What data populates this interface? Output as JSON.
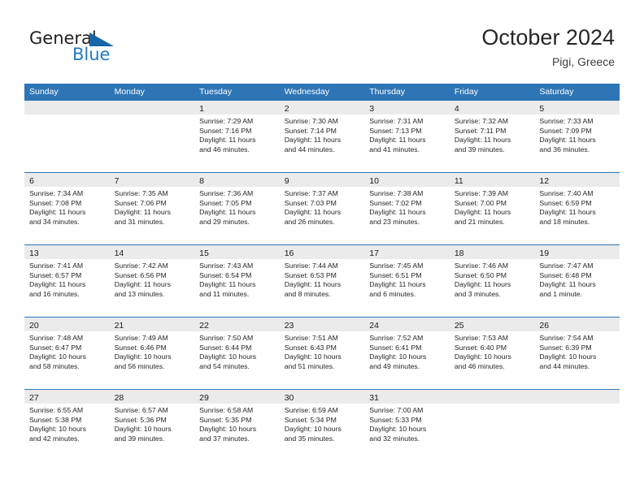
{
  "brand": {
    "name_part1": "General",
    "name_part2": "Blue",
    "triangle_icon": "triangle-logo-icon",
    "accent_color": "#1f7bc1"
  },
  "header": {
    "month_title": "October 2024",
    "location": "Pigi, Greece"
  },
  "colors": {
    "weekday_header_bg": "#2e75b6",
    "day_band_bg": "#ebebeb",
    "row_divider": "#2e75b6",
    "text": "#262626"
  },
  "weekdays": [
    "Sunday",
    "Monday",
    "Tuesday",
    "Wednesday",
    "Thursday",
    "Friday",
    "Saturday"
  ],
  "weeks": [
    [
      {
        "day": "",
        "sunrise": "",
        "sunset": "",
        "daylight_line1": "",
        "daylight_line2": "",
        "empty": true
      },
      {
        "day": "",
        "sunrise": "",
        "sunset": "",
        "daylight_line1": "",
        "daylight_line2": "",
        "empty": true
      },
      {
        "day": "1",
        "sunrise": "Sunrise: 7:29 AM",
        "sunset": "Sunset: 7:16 PM",
        "daylight_line1": "Daylight: 11 hours",
        "daylight_line2": "and 46 minutes."
      },
      {
        "day": "2",
        "sunrise": "Sunrise: 7:30 AM",
        "sunset": "Sunset: 7:14 PM",
        "daylight_line1": "Daylight: 11 hours",
        "daylight_line2": "and 44 minutes."
      },
      {
        "day": "3",
        "sunrise": "Sunrise: 7:31 AM",
        "sunset": "Sunset: 7:13 PM",
        "daylight_line1": "Daylight: 11 hours",
        "daylight_line2": "and 41 minutes."
      },
      {
        "day": "4",
        "sunrise": "Sunrise: 7:32 AM",
        "sunset": "Sunset: 7:11 PM",
        "daylight_line1": "Daylight: 11 hours",
        "daylight_line2": "and 39 minutes."
      },
      {
        "day": "5",
        "sunrise": "Sunrise: 7:33 AM",
        "sunset": "Sunset: 7:09 PM",
        "daylight_line1": "Daylight: 11 hours",
        "daylight_line2": "and 36 minutes."
      }
    ],
    [
      {
        "day": "6",
        "sunrise": "Sunrise: 7:34 AM",
        "sunset": "Sunset: 7:08 PM",
        "daylight_line1": "Daylight: 11 hours",
        "daylight_line2": "and 34 minutes."
      },
      {
        "day": "7",
        "sunrise": "Sunrise: 7:35 AM",
        "sunset": "Sunset: 7:06 PM",
        "daylight_line1": "Daylight: 11 hours",
        "daylight_line2": "and 31 minutes."
      },
      {
        "day": "8",
        "sunrise": "Sunrise: 7:36 AM",
        "sunset": "Sunset: 7:05 PM",
        "daylight_line1": "Daylight: 11 hours",
        "daylight_line2": "and 29 minutes."
      },
      {
        "day": "9",
        "sunrise": "Sunrise: 7:37 AM",
        "sunset": "Sunset: 7:03 PM",
        "daylight_line1": "Daylight: 11 hours",
        "daylight_line2": "and 26 minutes."
      },
      {
        "day": "10",
        "sunrise": "Sunrise: 7:38 AM",
        "sunset": "Sunset: 7:02 PM",
        "daylight_line1": "Daylight: 11 hours",
        "daylight_line2": "and 23 minutes."
      },
      {
        "day": "11",
        "sunrise": "Sunrise: 7:39 AM",
        "sunset": "Sunset: 7:00 PM",
        "daylight_line1": "Daylight: 11 hours",
        "daylight_line2": "and 21 minutes."
      },
      {
        "day": "12",
        "sunrise": "Sunrise: 7:40 AM",
        "sunset": "Sunset: 6:59 PM",
        "daylight_line1": "Daylight: 11 hours",
        "daylight_line2": "and 18 minutes."
      }
    ],
    [
      {
        "day": "13",
        "sunrise": "Sunrise: 7:41 AM",
        "sunset": "Sunset: 6:57 PM",
        "daylight_line1": "Daylight: 11 hours",
        "daylight_line2": "and 16 minutes."
      },
      {
        "day": "14",
        "sunrise": "Sunrise: 7:42 AM",
        "sunset": "Sunset: 6:56 PM",
        "daylight_line1": "Daylight: 11 hours",
        "daylight_line2": "and 13 minutes."
      },
      {
        "day": "15",
        "sunrise": "Sunrise: 7:43 AM",
        "sunset": "Sunset: 6:54 PM",
        "daylight_line1": "Daylight: 11 hours",
        "daylight_line2": "and 11 minutes."
      },
      {
        "day": "16",
        "sunrise": "Sunrise: 7:44 AM",
        "sunset": "Sunset: 6:53 PM",
        "daylight_line1": "Daylight: 11 hours",
        "daylight_line2": "and 8 minutes."
      },
      {
        "day": "17",
        "sunrise": "Sunrise: 7:45 AM",
        "sunset": "Sunset: 6:51 PM",
        "daylight_line1": "Daylight: 11 hours",
        "daylight_line2": "and 6 minutes."
      },
      {
        "day": "18",
        "sunrise": "Sunrise: 7:46 AM",
        "sunset": "Sunset: 6:50 PM",
        "daylight_line1": "Daylight: 11 hours",
        "daylight_line2": "and 3 minutes."
      },
      {
        "day": "19",
        "sunrise": "Sunrise: 7:47 AM",
        "sunset": "Sunset: 6:48 PM",
        "daylight_line1": "Daylight: 11 hours",
        "daylight_line2": "and 1 minute."
      }
    ],
    [
      {
        "day": "20",
        "sunrise": "Sunrise: 7:48 AM",
        "sunset": "Sunset: 6:47 PM",
        "daylight_line1": "Daylight: 10 hours",
        "daylight_line2": "and 58 minutes."
      },
      {
        "day": "21",
        "sunrise": "Sunrise: 7:49 AM",
        "sunset": "Sunset: 6:46 PM",
        "daylight_line1": "Daylight: 10 hours",
        "daylight_line2": "and 56 minutes."
      },
      {
        "day": "22",
        "sunrise": "Sunrise: 7:50 AM",
        "sunset": "Sunset: 6:44 PM",
        "daylight_line1": "Daylight: 10 hours",
        "daylight_line2": "and 54 minutes."
      },
      {
        "day": "23",
        "sunrise": "Sunrise: 7:51 AM",
        "sunset": "Sunset: 6:43 PM",
        "daylight_line1": "Daylight: 10 hours",
        "daylight_line2": "and 51 minutes."
      },
      {
        "day": "24",
        "sunrise": "Sunrise: 7:52 AM",
        "sunset": "Sunset: 6:41 PM",
        "daylight_line1": "Daylight: 10 hours",
        "daylight_line2": "and 49 minutes."
      },
      {
        "day": "25",
        "sunrise": "Sunrise: 7:53 AM",
        "sunset": "Sunset: 6:40 PM",
        "daylight_line1": "Daylight: 10 hours",
        "daylight_line2": "and 46 minutes."
      },
      {
        "day": "26",
        "sunrise": "Sunrise: 7:54 AM",
        "sunset": "Sunset: 6:39 PM",
        "daylight_line1": "Daylight: 10 hours",
        "daylight_line2": "and 44 minutes."
      }
    ],
    [
      {
        "day": "27",
        "sunrise": "Sunrise: 6:55 AM",
        "sunset": "Sunset: 5:38 PM",
        "daylight_line1": "Daylight: 10 hours",
        "daylight_line2": "and 42 minutes."
      },
      {
        "day": "28",
        "sunrise": "Sunrise: 6:57 AM",
        "sunset": "Sunset: 5:36 PM",
        "daylight_line1": "Daylight: 10 hours",
        "daylight_line2": "and 39 minutes."
      },
      {
        "day": "29",
        "sunrise": "Sunrise: 6:58 AM",
        "sunset": "Sunset: 5:35 PM",
        "daylight_line1": "Daylight: 10 hours",
        "daylight_line2": "and 37 minutes."
      },
      {
        "day": "30",
        "sunrise": "Sunrise: 6:59 AM",
        "sunset": "Sunset: 5:34 PM",
        "daylight_line1": "Daylight: 10 hours",
        "daylight_line2": "and 35 minutes."
      },
      {
        "day": "31",
        "sunrise": "Sunrise: 7:00 AM",
        "sunset": "Sunset: 5:33 PM",
        "daylight_line1": "Daylight: 10 hours",
        "daylight_line2": "and 32 minutes."
      },
      {
        "day": "",
        "sunrise": "",
        "sunset": "",
        "daylight_line1": "",
        "daylight_line2": "",
        "empty": true
      },
      {
        "day": "",
        "sunrise": "",
        "sunset": "",
        "daylight_line1": "",
        "daylight_line2": "",
        "empty": true
      }
    ]
  ]
}
